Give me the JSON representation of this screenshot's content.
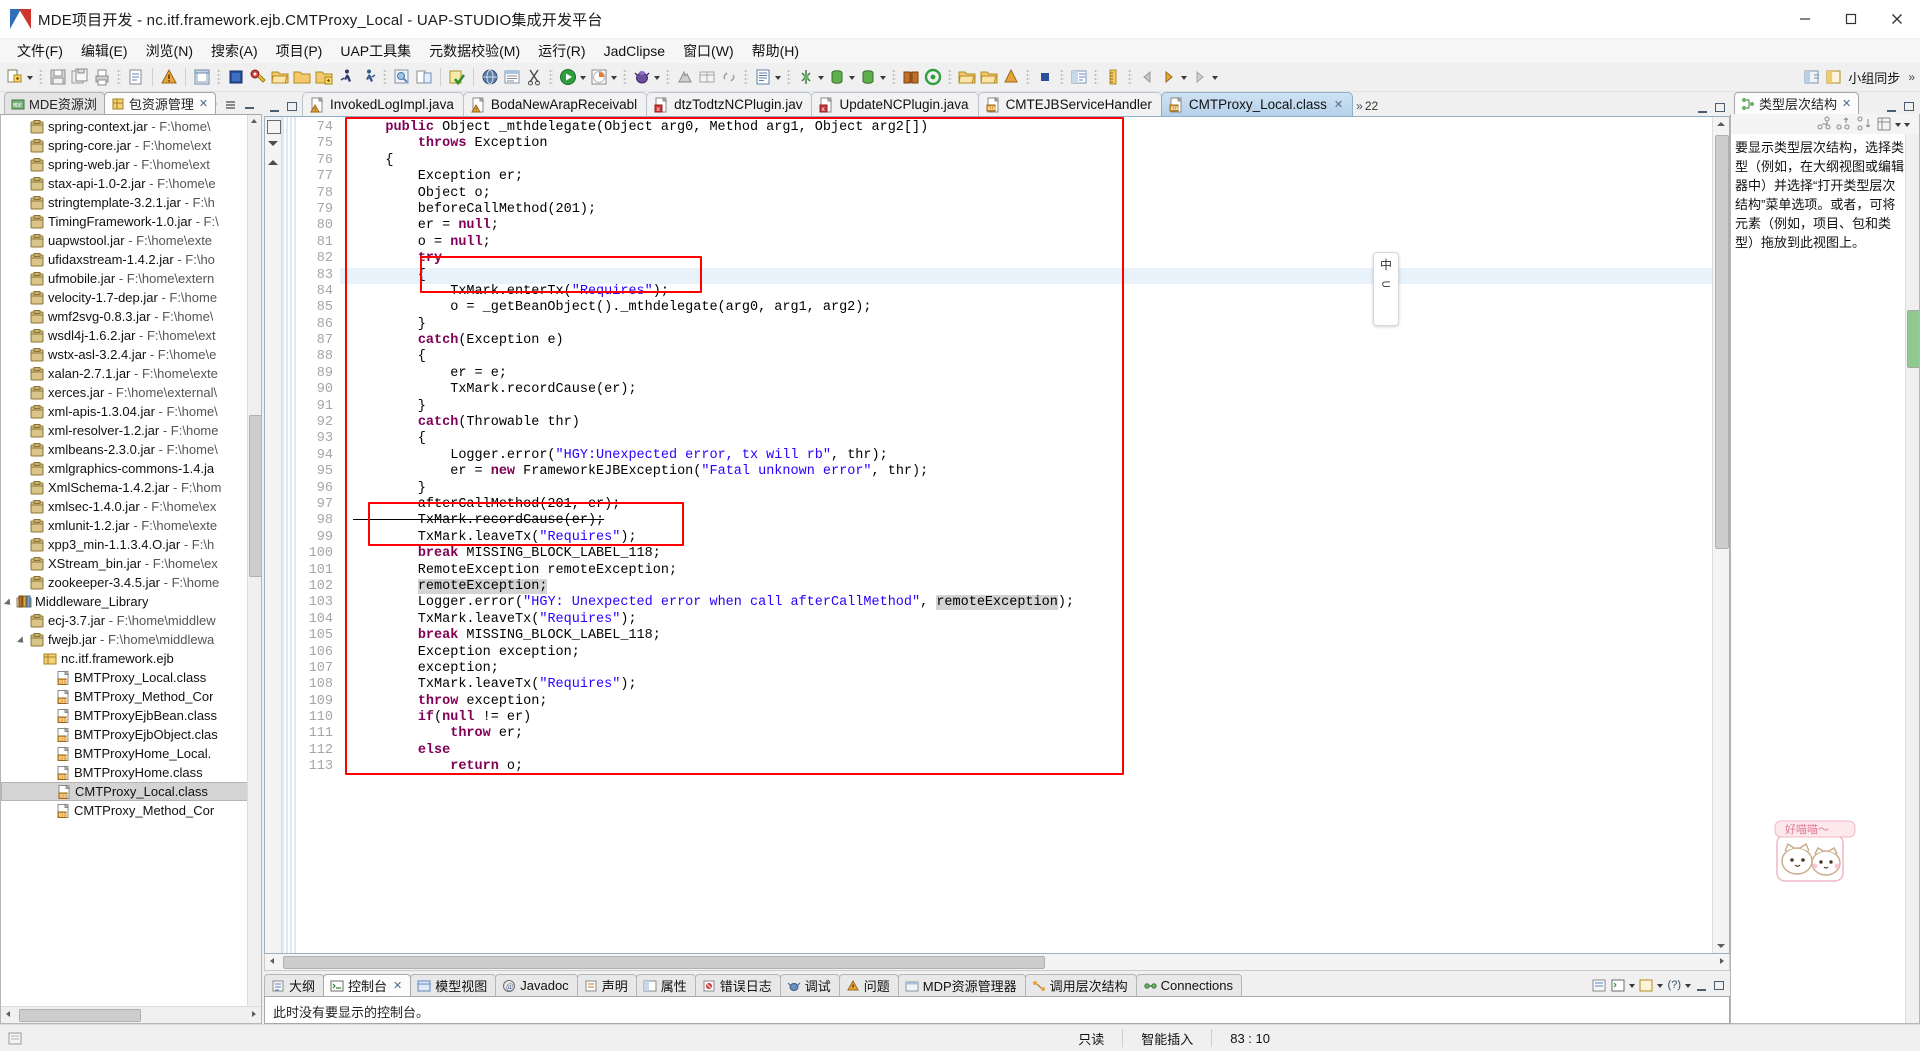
{
  "window": {
    "title": "MDE项目开发  -  nc.itf.framework.ejb.CMTProxy_Local  -  UAP-STUDIO集成开发平台",
    "minimize_label": "最小化",
    "maximize_label": "最大化",
    "close_label": "关闭"
  },
  "menubar": [
    {
      "label": "文件(F)"
    },
    {
      "label": "编辑(E)"
    },
    {
      "label": "浏览(N)"
    },
    {
      "label": "搜索(A)"
    },
    {
      "label": "项目(P)"
    },
    {
      "label": "UAP工具集"
    },
    {
      "label": "元数据校验(M)"
    },
    {
      "label": "运行(R)"
    },
    {
      "label": "JadClipse"
    },
    {
      "label": "窗口(W)"
    },
    {
      "label": "帮助(H)"
    }
  ],
  "toolbar": {
    "perspective_label": "小组同步",
    "overflow": "»"
  },
  "left_view": {
    "tabs": [
      {
        "label": "MDE资源浏",
        "icon": "mde-icon",
        "active": false
      },
      {
        "label": "包资源管理",
        "icon": "package-explorer-icon",
        "active": true,
        "close": "✕"
      }
    ],
    "tree": [
      {
        "indent": 1,
        "icon": "jar-icon",
        "label": "spring-context.jar",
        "suffix": " - F:\\home\\"
      },
      {
        "indent": 1,
        "icon": "jar-icon",
        "label": "spring-core.jar",
        "suffix": " - F:\\home\\ext"
      },
      {
        "indent": 1,
        "icon": "jar-icon",
        "label": "spring-web.jar",
        "suffix": " - F:\\home\\ext"
      },
      {
        "indent": 1,
        "icon": "jar-icon",
        "label": "stax-api-1.0-2.jar",
        "suffix": " - F:\\home\\e"
      },
      {
        "indent": 1,
        "icon": "jar-icon",
        "label": "stringtemplate-3.2.1.jar",
        "suffix": " - F:\\h"
      },
      {
        "indent": 1,
        "icon": "jar-icon",
        "label": "TimingFramework-1.0.jar",
        "suffix": " - F:\\"
      },
      {
        "indent": 1,
        "icon": "jar-icon",
        "label": "uapwstool.jar",
        "suffix": " - F:\\home\\exte"
      },
      {
        "indent": 1,
        "icon": "jar-icon",
        "label": "ufidaxstream-1.4.2.jar",
        "suffix": " - F:\\ho"
      },
      {
        "indent": 1,
        "icon": "jar-icon",
        "label": "ufmobile.jar",
        "suffix": " - F:\\home\\extern"
      },
      {
        "indent": 1,
        "icon": "jar-icon",
        "label": "velocity-1.7-dep.jar",
        "suffix": " - F:\\home"
      },
      {
        "indent": 1,
        "icon": "jar-icon",
        "label": "wmf2svg-0.8.3.jar",
        "suffix": " - F:\\home\\"
      },
      {
        "indent": 1,
        "icon": "jar-icon",
        "label": "wsdl4j-1.6.2.jar",
        "suffix": " - F:\\home\\ext"
      },
      {
        "indent": 1,
        "icon": "jar-icon",
        "label": "wstx-asl-3.2.4.jar",
        "suffix": " - F:\\home\\e"
      },
      {
        "indent": 1,
        "icon": "jar-icon",
        "label": "xalan-2.7.1.jar",
        "suffix": " - F:\\home\\exte"
      },
      {
        "indent": 1,
        "icon": "jar-icon",
        "label": "xerces.jar",
        "suffix": " - F:\\home\\external\\"
      },
      {
        "indent": 1,
        "icon": "jar-icon",
        "label": "xml-apis-1.3.04.jar",
        "suffix": " - F:\\home\\"
      },
      {
        "indent": 1,
        "icon": "jar-icon",
        "label": "xml-resolver-1.2.jar",
        "suffix": " - F:\\home"
      },
      {
        "indent": 1,
        "icon": "jar-icon",
        "label": "xmlbeans-2.3.0.jar",
        "suffix": " - F:\\home\\"
      },
      {
        "indent": 1,
        "icon": "jar-icon",
        "label": "xmlgraphics-commons-1.4.ja",
        "suffix": ""
      },
      {
        "indent": 1,
        "icon": "jar-icon",
        "label": "XmlSchema-1.4.2.jar",
        "suffix": " - F:\\hom"
      },
      {
        "indent": 1,
        "icon": "jar-icon",
        "label": "xmlsec-1.4.0.jar",
        "suffix": " - F:\\home\\ex"
      },
      {
        "indent": 1,
        "icon": "jar-icon",
        "label": "xmlunit-1.2.jar",
        "suffix": " - F:\\home\\exte"
      },
      {
        "indent": 1,
        "icon": "jar-icon",
        "label": "xpp3_min-1.1.3.4.O.jar",
        "suffix": " - F:\\h"
      },
      {
        "indent": 1,
        "icon": "jar-icon",
        "label": "XStream_bin.jar",
        "suffix": " - F:\\home\\ex"
      },
      {
        "indent": 1,
        "icon": "jar-icon",
        "label": "zookeeper-3.4.5.jar",
        "suffix": " - F:\\home"
      },
      {
        "indent": 0,
        "icon": "library-icon",
        "label": "Middleware_Library",
        "suffix": "",
        "expanded": true
      },
      {
        "indent": 1,
        "icon": "jar-icon",
        "label": "ecj-3.7.jar",
        "suffix": " - F:\\home\\middlew"
      },
      {
        "indent": 1,
        "icon": "jar-icon",
        "label": "fwejb.jar",
        "suffix": " - F:\\home\\middlewa",
        "expanded": true
      },
      {
        "indent": 2,
        "icon": "package-icon",
        "label": "nc.itf.framework.ejb",
        "suffix": ""
      },
      {
        "indent": 3,
        "icon": "class-icon",
        "label": "BMTProxy_Local.class",
        "suffix": ""
      },
      {
        "indent": 3,
        "icon": "class-icon",
        "label": "BMTProxy_Method_Cor",
        "suffix": ""
      },
      {
        "indent": 3,
        "icon": "class-icon",
        "label": "BMTProxyEjbBean.class",
        "suffix": ""
      },
      {
        "indent": 3,
        "icon": "class-icon",
        "label": "BMTProxyEjbObject.clas",
        "suffix": ""
      },
      {
        "indent": 3,
        "icon": "class-icon",
        "label": "BMTProxyHome_Local.",
        "suffix": ""
      },
      {
        "indent": 3,
        "icon": "class-icon",
        "label": "BMTProxyHome.class",
        "suffix": ""
      },
      {
        "indent": 3,
        "icon": "class-icon",
        "label": "CMTProxy_Local.class",
        "suffix": "",
        "selected": true
      },
      {
        "indent": 3,
        "icon": "class-icon",
        "label": "CMTProxy_Method_Cor",
        "suffix": ""
      }
    ]
  },
  "editor": {
    "tabs": [
      {
        "label": "InvokedLogImpl.java",
        "icon": "java-warning-icon",
        "active": false
      },
      {
        "label": "BodaNewArapReceivabl",
        "icon": "java-warning-icon",
        "active": false
      },
      {
        "label": "dtzTodtzNCPlugin.jav",
        "icon": "java-error-icon",
        "active": false
      },
      {
        "label": "UpdateNCPlugin.java",
        "icon": "java-error-icon",
        "active": false
      },
      {
        "label": "CMTEJBServiceHandler",
        "icon": "class-file-icon",
        "active": false
      },
      {
        "label": "CMTProxy_Local.class",
        "icon": "class-file-icon",
        "active": true,
        "close": "✕"
      }
    ],
    "overflow_count": "22",
    "first_line": 74,
    "lines": [
      {
        "n": 74,
        "tokens": [
          {
            "t": "    ",
            "c": "p"
          },
          {
            "t": "public",
            "c": "kw"
          },
          {
            "t": " Object _mthdelegate(Object arg0, Method arg1, Object arg2[])",
            "c": "p"
          }
        ]
      },
      {
        "n": 75,
        "tokens": [
          {
            "t": "        ",
            "c": "p"
          },
          {
            "t": "throws",
            "c": "kw"
          },
          {
            "t": " Exception",
            "c": "p"
          }
        ]
      },
      {
        "n": 76,
        "tokens": [
          {
            "t": "    {",
            "c": "p"
          }
        ]
      },
      {
        "n": 77,
        "tokens": [
          {
            "t": "        Exception er;",
            "c": "p"
          }
        ]
      },
      {
        "n": 78,
        "tokens": [
          {
            "t": "        Object o;",
            "c": "p"
          }
        ]
      },
      {
        "n": 79,
        "tokens": [
          {
            "t": "        beforeCallMethod(201);",
            "c": "p"
          }
        ]
      },
      {
        "n": 80,
        "tokens": [
          {
            "t": "        er = ",
            "c": "p"
          },
          {
            "t": "null",
            "c": "kw"
          },
          {
            "t": ";",
            "c": "p"
          }
        ]
      },
      {
        "n": 81,
        "tokens": [
          {
            "t": "        o = ",
            "c": "p"
          },
          {
            "t": "null",
            "c": "kw"
          },
          {
            "t": ";",
            "c": "p"
          }
        ]
      },
      {
        "n": 82,
        "tokens": [
          {
            "t": "        ",
            "c": "p"
          },
          {
            "t": "try",
            "c": "kw"
          }
        ]
      },
      {
        "n": 83,
        "tokens": [
          {
            "t": "        {",
            "c": "p"
          }
        ],
        "hl": true
      },
      {
        "n": 84,
        "tokens": [
          {
            "t": "            TxMark.enterTx(",
            "c": "p"
          },
          {
            "t": "\"Requires\"",
            "c": "str"
          },
          {
            "t": ");",
            "c": "p"
          }
        ]
      },
      {
        "n": 85,
        "tokens": [
          {
            "t": "            o = _getBeanObject()._mthdelegate(arg0, arg1, arg2);",
            "c": "p"
          }
        ]
      },
      {
        "n": 86,
        "tokens": [
          {
            "t": "        }",
            "c": "p"
          }
        ]
      },
      {
        "n": 87,
        "tokens": [
          {
            "t": "        ",
            "c": "p"
          },
          {
            "t": "catch",
            "c": "kw"
          },
          {
            "t": "(Exception e)",
            "c": "p"
          }
        ]
      },
      {
        "n": 88,
        "tokens": [
          {
            "t": "        {",
            "c": "p"
          }
        ]
      },
      {
        "n": 89,
        "tokens": [
          {
            "t": "            er = e;",
            "c": "p"
          }
        ]
      },
      {
        "n": 90,
        "tokens": [
          {
            "t": "            TxMark.recordCause(er);",
            "c": "p"
          }
        ]
      },
      {
        "n": 91,
        "tokens": [
          {
            "t": "        }",
            "c": "p"
          }
        ]
      },
      {
        "n": 92,
        "tokens": [
          {
            "t": "        ",
            "c": "p"
          },
          {
            "t": "catch",
            "c": "kw"
          },
          {
            "t": "(Throwable thr)",
            "c": "p"
          }
        ]
      },
      {
        "n": 93,
        "tokens": [
          {
            "t": "        {",
            "c": "p"
          }
        ]
      },
      {
        "n": 94,
        "tokens": [
          {
            "t": "            Logger.error(",
            "c": "p"
          },
          {
            "t": "\"HGY:Unexpected error, tx will rb\"",
            "c": "str"
          },
          {
            "t": ", thr);",
            "c": "p"
          }
        ]
      },
      {
        "n": 95,
        "tokens": [
          {
            "t": "            er = ",
            "c": "p"
          },
          {
            "t": "new",
            "c": "kw"
          },
          {
            "t": " FrameworkEJBException(",
            "c": "p"
          },
          {
            "t": "\"Fatal unknown error\"",
            "c": "str"
          },
          {
            "t": ", thr);",
            "c": "p"
          }
        ]
      },
      {
        "n": 96,
        "tokens": [
          {
            "t": "        }",
            "c": "p"
          }
        ]
      },
      {
        "n": 97,
        "tokens": [
          {
            "t": "        afterCallMethod(201, er);",
            "c": "p"
          }
        ]
      },
      {
        "n": 98,
        "tokens": [
          {
            "t": "        TxMark.recordCause(er);",
            "c": "strike"
          }
        ]
      },
      {
        "n": 99,
        "tokens": [
          {
            "t": "        TxMark.leaveTx(",
            "c": "p"
          },
          {
            "t": "\"Requires\"",
            "c": "str"
          },
          {
            "t": ");",
            "c": "p"
          }
        ]
      },
      {
        "n": 100,
        "tokens": [
          {
            "t": "        ",
            "c": "p"
          },
          {
            "t": "break",
            "c": "kw"
          },
          {
            "t": " MISSING_BLOCK_LABEL_118;",
            "c": "p"
          }
        ]
      },
      {
        "n": 101,
        "tokens": [
          {
            "t": "        RemoteException remoteException;",
            "c": "p"
          }
        ]
      },
      {
        "n": 102,
        "tokens": [
          {
            "t": "        ",
            "c": "p"
          },
          {
            "t": "remoteException;",
            "c": "occ"
          }
        ]
      },
      {
        "n": 103,
        "tokens": [
          {
            "t": "        Logger.error(",
            "c": "p"
          },
          {
            "t": "\"HGY: Unexpected error when call afterCallMethod\"",
            "c": "str"
          },
          {
            "t": ", ",
            "c": "p"
          },
          {
            "t": "remoteException",
            "c": "occ"
          },
          {
            "t": ");",
            "c": "p"
          }
        ]
      },
      {
        "n": 104,
        "tokens": [
          {
            "t": "        TxMark.leaveTx(",
            "c": "p"
          },
          {
            "t": "\"Requires\"",
            "c": "str"
          },
          {
            "t": ");",
            "c": "p"
          }
        ]
      },
      {
        "n": 105,
        "tokens": [
          {
            "t": "        ",
            "c": "p"
          },
          {
            "t": "break",
            "c": "kw"
          },
          {
            "t": " MISSING_BLOCK_LABEL_118;",
            "c": "p"
          }
        ]
      },
      {
        "n": 106,
        "tokens": [
          {
            "t": "        Exception exception;",
            "c": "p"
          }
        ]
      },
      {
        "n": 107,
        "tokens": [
          {
            "t": "        exception;",
            "c": "p"
          }
        ]
      },
      {
        "n": 108,
        "tokens": [
          {
            "t": "        TxMark.leaveTx(",
            "c": "p"
          },
          {
            "t": "\"Requires\"",
            "c": "str"
          },
          {
            "t": ");",
            "c": "p"
          }
        ]
      },
      {
        "n": 109,
        "tokens": [
          {
            "t": "        ",
            "c": "p"
          },
          {
            "t": "throw",
            "c": "kw"
          },
          {
            "t": " exception;",
            "c": "p"
          }
        ]
      },
      {
        "n": 110,
        "tokens": [
          {
            "t": "        ",
            "c": "p"
          },
          {
            "t": "if",
            "c": "kw"
          },
          {
            "t": "(",
            "c": "p"
          },
          {
            "t": "null",
            "c": "kw"
          },
          {
            "t": " != er)",
            "c": "p"
          }
        ]
      },
      {
        "n": 111,
        "tokens": [
          {
            "t": "            ",
            "c": "p"
          },
          {
            "t": "throw",
            "c": "kw"
          },
          {
            "t": " er;",
            "c": "p"
          }
        ]
      },
      {
        "n": 112,
        "tokens": [
          {
            "t": "        ",
            "c": "p"
          },
          {
            "t": "else",
            "c": "kw"
          }
        ]
      },
      {
        "n": 113,
        "tokens": [
          {
            "t": "            ",
            "c": "p"
          },
          {
            "t": "return",
            "c": "kw"
          },
          {
            "t": " o;",
            "c": "p"
          }
        ]
      }
    ]
  },
  "bottom_view": {
    "tabs": [
      {
        "label": "大纲",
        "icon": "outline-icon",
        "active": false
      },
      {
        "label": "控制台",
        "icon": "console-icon",
        "active": true,
        "close": "✕"
      },
      {
        "label": "模型视图",
        "icon": "model-view-icon",
        "active": false
      },
      {
        "label": "Javadoc",
        "icon": "javadoc-icon",
        "active": false
      },
      {
        "label": "声明",
        "icon": "declaration-icon",
        "active": false
      },
      {
        "label": "属性",
        "icon": "properties-icon",
        "active": false
      },
      {
        "label": "错误日志",
        "icon": "error-log-icon",
        "active": false
      },
      {
        "label": "调试",
        "icon": "debug-icon",
        "active": false
      },
      {
        "label": "问题",
        "icon": "problems-icon",
        "active": false
      },
      {
        "label": "MDP资源管理器",
        "icon": "mdp-explorer-icon",
        "active": false
      },
      {
        "label": "调用层次结构",
        "icon": "call-hierarchy-icon",
        "active": false
      },
      {
        "label": "Connections",
        "icon": "connections-icon",
        "active": false
      }
    ],
    "content": "此时没有要显示的控制台。"
  },
  "right_view": {
    "tab": {
      "label": "类型层次结构",
      "icon": "type-hierarchy-icon",
      "close": "✕"
    },
    "message": "要显示类型层次结构，选择类型（例如，在大纲视图或编辑器中）并选择“打开类型层次结构”菜单选项。或者，可将元素（例如，项目、包和类型）拖放到此视图上。",
    "mascot_text": "好喵喵～"
  },
  "ime": {
    "lang": "中",
    "mode": "⊂"
  },
  "statusbar": {
    "readonly": "只读",
    "insert_mode": "智能插入",
    "position": "83 : 10"
  },
  "colors": {
    "accent": "#3a6ea5",
    "keyword": "#7f0055",
    "string": "#2a00ff",
    "annotation_box": "#ff0000",
    "active_tab": "#b5d1ea",
    "highlight_line": "#e8f2fb"
  }
}
